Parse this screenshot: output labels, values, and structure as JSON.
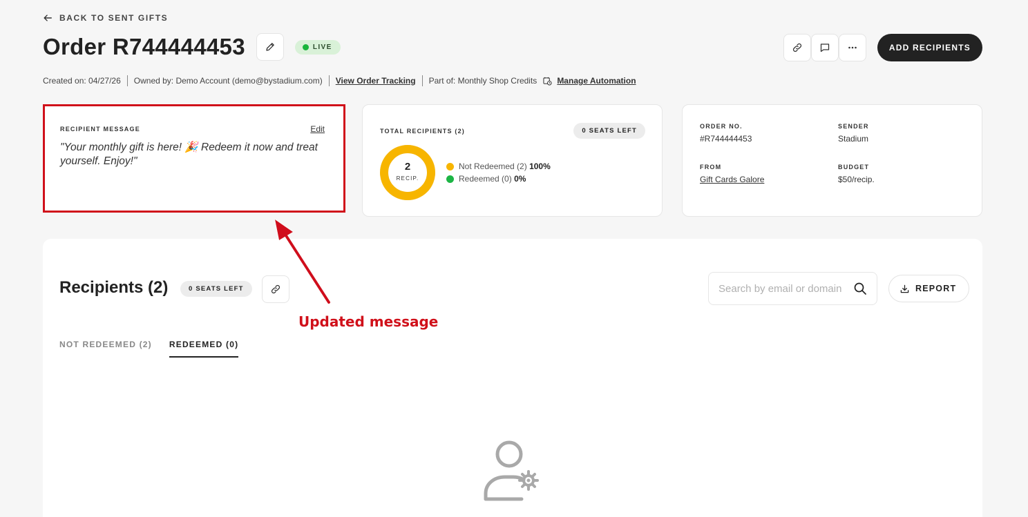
{
  "nav": {
    "back_label": "BACK TO SENT GIFTS"
  },
  "header": {
    "title": "Order R744444453",
    "status_badge": "LIVE",
    "add_recipients_label": "ADD RECIPIENTS"
  },
  "meta": {
    "created": "Created on: 04/27/26",
    "owned_by": "Owned by: Demo Account (demo@bystadium.com)",
    "tracking_link": "View Order Tracking",
    "part_of": "Part of: Monthly Shop Credits",
    "automation_link": "Manage Automation"
  },
  "recipient_message": {
    "label": "RECIPIENT MESSAGE",
    "edit_label": "Edit",
    "text": "\"Your monthly gift is here! 🎉 Redeem it now and treat yourself. Enjoy!\""
  },
  "totals": {
    "label": "TOTAL RECIPIENTS (2)",
    "seats_left": "0 SEATS LEFT",
    "donut_count": "2",
    "donut_unit": "RECIP.",
    "not_redeemed_fraction": 1.0,
    "redeemed_fraction": 0.0,
    "legend": [
      {
        "label": "Not Redeemed (2)",
        "pct": "100%",
        "color": "#f7b500"
      },
      {
        "label": "Redeemed (0)",
        "pct": "0%",
        "color": "#1db545"
      }
    ]
  },
  "order_info": {
    "order_no_label": "ORDER NO.",
    "order_no": "#R744444453",
    "sender_label": "SENDER",
    "sender": "Stadium",
    "from_label": "FROM",
    "from": "Gift Cards Galore",
    "budget_label": "BUDGET",
    "budget": "$50/recip."
  },
  "annotation": {
    "text": "Updated message",
    "color": "#d0101a"
  },
  "recipients": {
    "title": "Recipients (2)",
    "seats_left": "0 SEATS LEFT",
    "search_placeholder": "Search by email or domain",
    "report_label": "REPORT",
    "tabs": [
      {
        "label": "NOT REDEEMED (2)",
        "active": false
      },
      {
        "label": "REDEEMED (0)",
        "active": true
      }
    ]
  }
}
